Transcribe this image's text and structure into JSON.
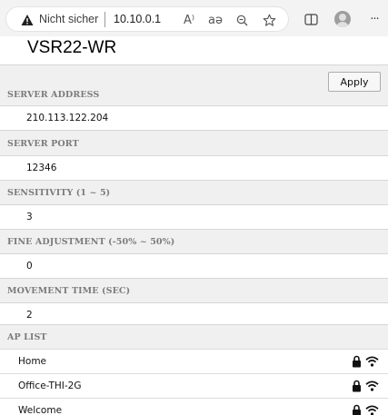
{
  "browser": {
    "security_warning": "Nicht sicher",
    "address": "10.10.0.1",
    "read_aloud_glyph": "A⁾",
    "translate_glyph": "aə",
    "zoom_icon": "zoom-out-icon",
    "favorite_icon": "star-icon",
    "split_screen_icon": "split-screen-icon",
    "more_glyph": "···"
  },
  "page": {
    "title": "VSR22-WR",
    "apply_label": "Apply"
  },
  "settings": [
    {
      "label": "SERVER ADDRESS",
      "value": "210.113.122.204"
    },
    {
      "label": "SERVER PORT",
      "value": "12346"
    },
    {
      "label": "SENSITIVITY (1 ~ 5)",
      "value": "3"
    },
    {
      "label": "FINE ADJUSTMENT (-50% ~ 50%)",
      "value": "0"
    },
    {
      "label": "MOVEMENT TIME (SEC)",
      "value": "2"
    }
  ],
  "ap_list": {
    "label": "AP LIST",
    "items": [
      {
        "name": "Home",
        "secured": true
      },
      {
        "name": "Office-THI-2G",
        "secured": true
      },
      {
        "name": "Welcome",
        "secured": true
      }
    ]
  },
  "colors": {
    "header_bg": "#f0f0f0",
    "header_text": "#7b7b7b",
    "divider": "#d6d6d6"
  }
}
